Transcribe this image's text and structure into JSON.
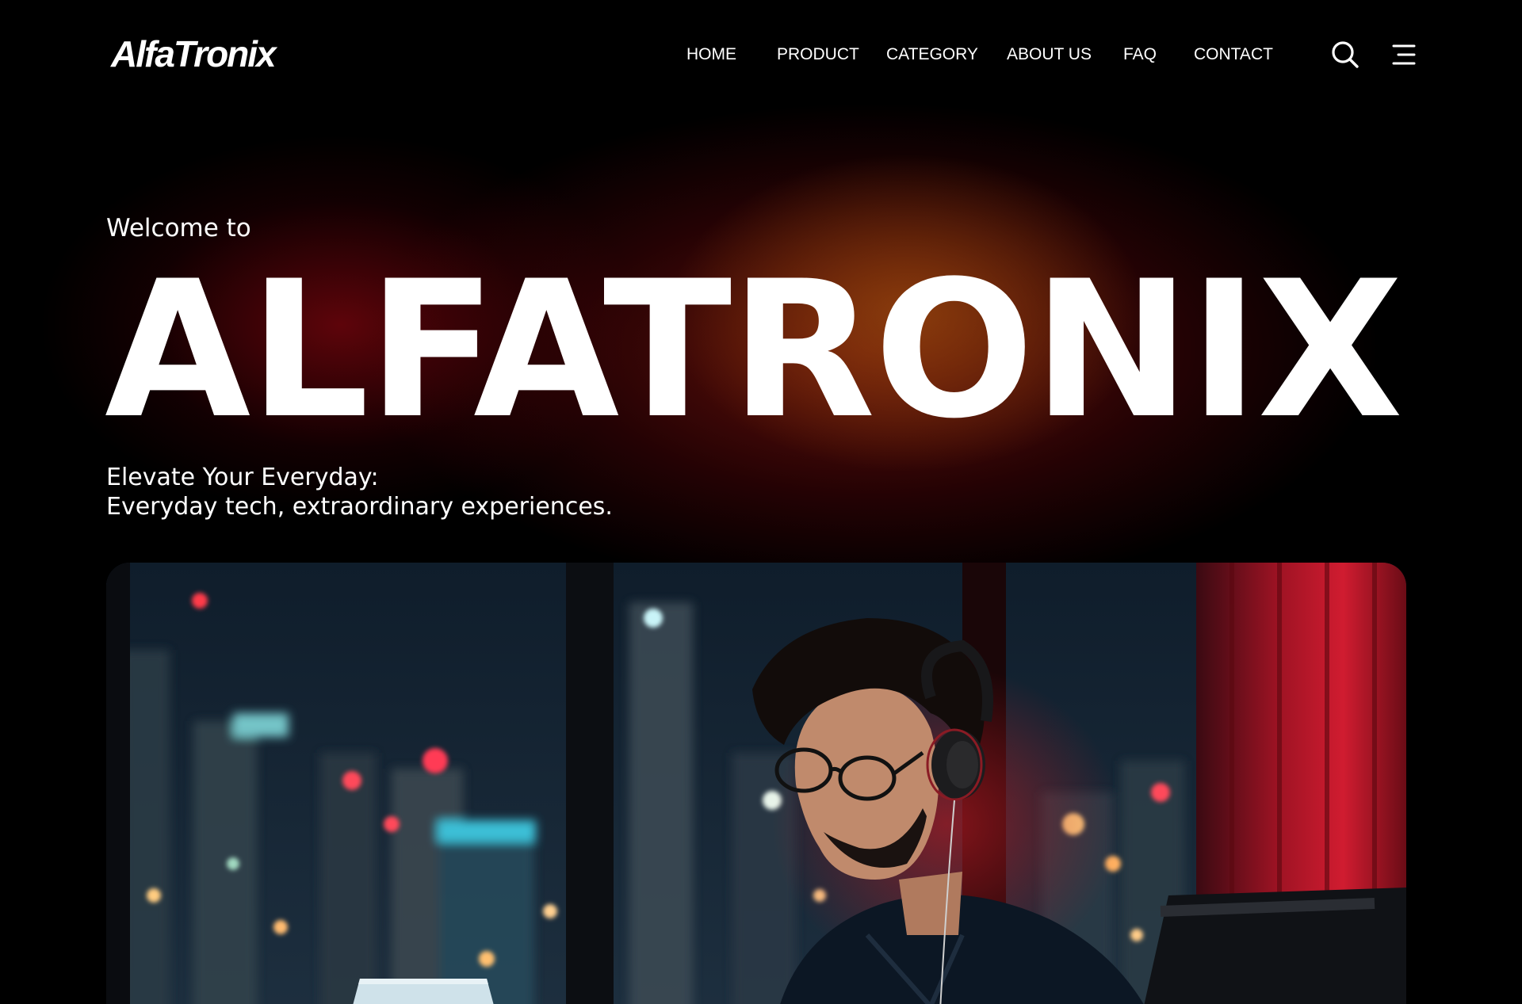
{
  "brand": {
    "logo_text": "AlfaTronix"
  },
  "nav": {
    "items": [
      "HOME",
      "PRODUCT",
      "CATEGORY",
      "ABOUT US",
      "FAQ",
      "CONTACT"
    ],
    "icons": [
      "search-icon",
      "menu-icon"
    ]
  },
  "hero": {
    "welcome": "Welcome to",
    "title": "ALFATRONIX",
    "tagline_line1": "Elevate Your Everyday:",
    "tagline_line2": "Everyday tech, extraordinary experiences."
  },
  "colors": {
    "background": "#000000",
    "glow_orange": "#8C3E0C",
    "glow_red": "#6E050C",
    "text": "#FFFFFF",
    "curtain_red": "#C0182A"
  },
  "image": {
    "subject": "man-with-headphones-and-glasses-at-laptop-night-city-window"
  }
}
